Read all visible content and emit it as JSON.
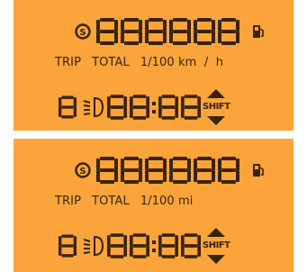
{
  "colors": {
    "panel": "#fca43c",
    "segment": "#3a2400",
    "background": "#ffffff"
  },
  "panels": [
    {
      "icons": [
        "speed-s-icon",
        "fuel-pump-icon",
        "headlight-icon",
        "shift-arrows-icon"
      ],
      "labels": {
        "trip": "TRIP",
        "total": "TOTAL",
        "units": "1/100 km  /  h"
      },
      "shift_label": "SHIFT"
    },
    {
      "icons": [
        "speed-s-icon",
        "fuel-pump-icon",
        "headlight-icon",
        "shift-arrows-icon"
      ],
      "labels": {
        "trip": "TRIP",
        "total": "TOTAL",
        "units": "1/100 mi"
      },
      "shift_label": "SHIFT"
    }
  ]
}
